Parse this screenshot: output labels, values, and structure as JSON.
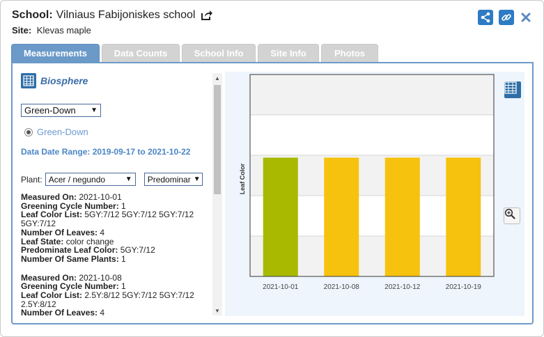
{
  "header": {
    "school_label": "School:",
    "school_name": "Vilniaus Fabijoniskes school",
    "site_label": "Site:",
    "site_name": "Klevas maple"
  },
  "tabs": [
    {
      "label": "Measurements",
      "active": true
    },
    {
      "label": "Data Counts",
      "active": false
    },
    {
      "label": "School Info",
      "active": false
    },
    {
      "label": "Site Info",
      "active": false
    },
    {
      "label": "Photos",
      "active": false
    }
  ],
  "left": {
    "protocol_title": "Biosphere",
    "protocol_select": "Green-Down",
    "radio_label": "Green-Down",
    "date_range_label": "Data Date Range:",
    "date_range_value": "2019-09-17 to 2021-10-22",
    "plant_label": "Plant:",
    "plant_select": "Acer / negundo",
    "predominant_select": "Predominar",
    "records": [
      {
        "measured_on_label": "Measured On:",
        "measured_on": "2021-10-01",
        "cycle_label": "Greening Cycle Number:",
        "cycle": "1",
        "color_list_label": "Leaf Color List:",
        "color_list": "5GY:7/12 5GY:7/12 5GY:7/12",
        "color_list_cont": "5GY:7/12",
        "leaves_label": "Number Of Leaves:",
        "leaves": "4",
        "state_label": "Leaf State:",
        "state": "color change",
        "predominate_label": "Predominate Leaf Color:",
        "predominate": "5GY:7/12",
        "same_plants_label": "Number Of Same Plants:",
        "same_plants": "1"
      },
      {
        "measured_on_label": "Measured On:",
        "measured_on": "2021-10-08",
        "cycle_label": "Greening Cycle Number:",
        "cycle": "1",
        "color_list_label": "Leaf Color List:",
        "color_list": "2.5Y:8/12 5GY:7/12 5GY:7/12",
        "color_list_cont": "2.5Y:8/12",
        "leaves_label": "Number Of Leaves:",
        "leaves": "4"
      }
    ]
  },
  "chart_data": {
    "type": "bar",
    "ylabel": "Leaf Color",
    "categories": [
      "2021-10-01",
      "2021-10-08",
      "2021-10-12",
      "2021-10-19"
    ],
    "values": [
      1,
      1,
      1,
      1
    ],
    "ylim": [
      0,
      1.7
    ],
    "bar_colors": [
      "#a8b900",
      "#f7c20d",
      "#f7c20d",
      "#f7c20d"
    ],
    "grid": true
  },
  "colors": {
    "accent": "#6b9ac9",
    "icon_blue": "#2e7bc4",
    "link_blue": "#4a86c6"
  }
}
